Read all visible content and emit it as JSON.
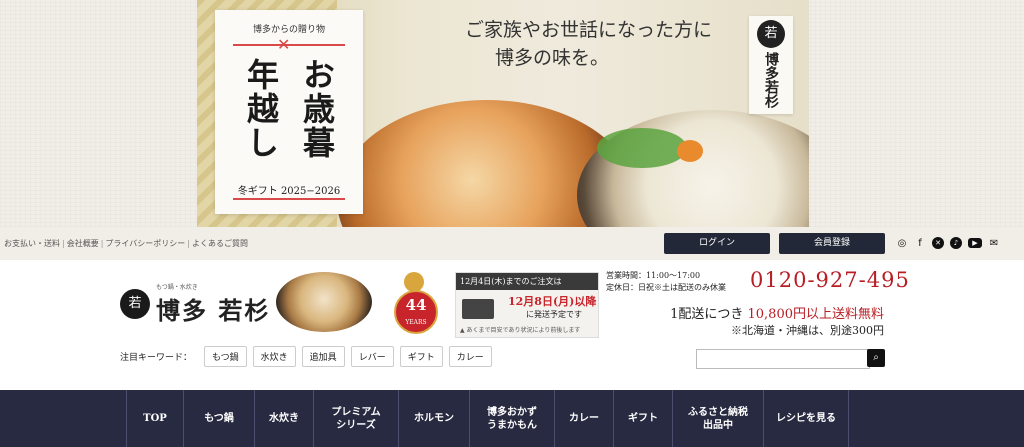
{
  "banner": {
    "card_top": "博多からの贈り物",
    "card_col_right": "お歳暮",
    "card_col_left": "年越し",
    "card_bottom": "冬ギフト 2025−2026",
    "tagline_1": "ご家族やお世話になった方に",
    "tagline_2": "博多の味を。",
    "logo_text": "博多若杉"
  },
  "utility": {
    "links": [
      "お支払い・送料",
      "会社概要",
      "プライバシーポリシー",
      "よくあるご質問"
    ],
    "login": "ログイン",
    "register": "会員登録",
    "socials": [
      "instagram-icon",
      "facebook-icon",
      "x-icon",
      "tiktok-icon",
      "youtube-icon",
      "mail-icon"
    ]
  },
  "header": {
    "logo_small": "もつ鍋・水炊き",
    "logo_name": "博多 若杉",
    "badge_number": "44",
    "badge_text": "YEARS",
    "notice_head": "12月4日(木)までのご注文は",
    "notice_date": "12月8日(月)以降",
    "notice_sub": "に発送予定です",
    "notice_foot": "▲ あくまで目安であり状況により前後します",
    "hours_1": "営業時間：11:00〜17:00",
    "hours_2": "定休日：日祝※土は配送のみ休業",
    "phone": "0120-927-495",
    "ship_prefix": "1配送につき",
    "ship_amount": "10,800円以上送料無料",
    "ship_note": "※北海道・沖縄は、別途300円"
  },
  "keywords": {
    "label": "注目キーワード：",
    "items": [
      "もつ鍋",
      "水炊き",
      "追加具",
      "レバー",
      "ギフト",
      "カレー"
    ]
  },
  "search": {
    "placeholder": ""
  },
  "nav": {
    "items": [
      {
        "label": "TOP",
        "width": 56
      },
      {
        "label": "もつ鍋",
        "width": 70
      },
      {
        "label": "水炊き",
        "width": 58
      },
      {
        "label": "プレミアム\nシリーズ",
        "width": 84
      },
      {
        "label": "ホルモン",
        "width": 70
      },
      {
        "label": "博多おかず\nうまかもん",
        "width": 84
      },
      {
        "label": "カレー",
        "width": 58
      },
      {
        "label": "ギフト",
        "width": 58
      },
      {
        "label": "ふるさと納税\n出品中",
        "width": 90
      },
      {
        "label": "レシピを見る",
        "width": 84
      }
    ]
  },
  "colors": {
    "nav_bg": "#272a41",
    "accent_red": "#b81e24",
    "button_dark": "#232838"
  }
}
